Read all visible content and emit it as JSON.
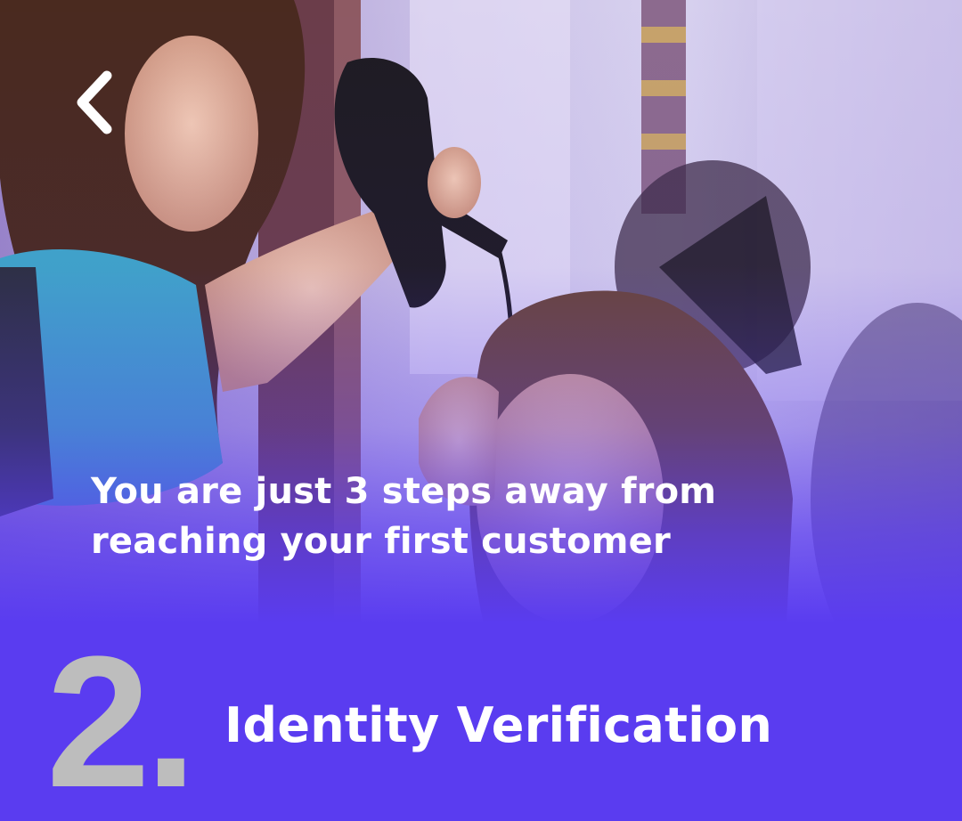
{
  "header": {
    "back_icon": "chevron-left-icon"
  },
  "hero": {
    "image_subject": "salon-hairdryer-photo",
    "headline": "You are just 3 steps away from reaching your first customer"
  },
  "step": {
    "number": "2.",
    "title": "Identity Verification"
  },
  "colors": {
    "accent": "#5a3cf0",
    "step_number": "#bdbdbd",
    "text": "#ffffff"
  }
}
